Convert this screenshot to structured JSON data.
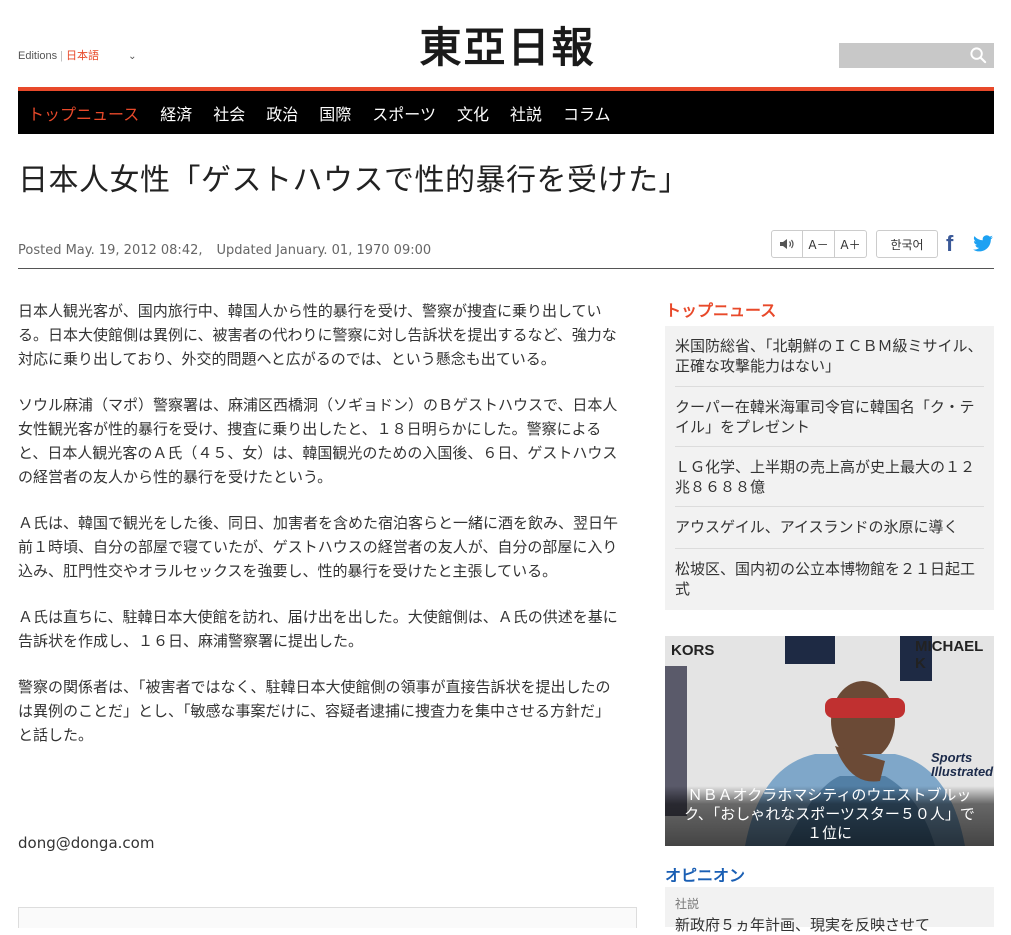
{
  "header": {
    "editions_label": "Editions",
    "edition_lang": "日本語",
    "logo_text": "東亞日報",
    "search_placeholder": ""
  },
  "nav": {
    "items": [
      "トップニュース",
      "経済",
      "社会",
      "政治",
      "国際",
      "スポーツ",
      "文化",
      "社説",
      "コラム"
    ],
    "active_index": 0
  },
  "article": {
    "title": "日本人女性「ゲストハウスで性的暴行を受けた」",
    "posted": "Posted May. 19, 2012 08:42,",
    "updated": "Updated January. 01, 1970 09:00",
    "paragraphs": [
      "日本人観光客が、国内旅行中、韓国人から性的暴行を受け、警察が捜査に乗り出している。日本大使館側は異例に、被害者の代わりに警察に対し告訴状を提出するなど、強力な対応に乗り出しており、外交的問題へと広がるのでは、という懸念も出ている。",
      "ソウル麻浦（マポ）警察署は、麻浦区西橋洞（ソギョドン）のＢゲストハウスで、日本人女性観光客が性的暴行を受け、捜査に乗り出したと、１８日明らかにした。警察によると、日本人観光客のＡ氏（４５、女）は、韓国観光のための入国後、６日、ゲストハウスの経営者の友人から性的暴行を受けたという。",
      "Ａ氏は、韓国で観光をした後、同日、加害者を含めた宿泊客らと一緒に酒を飲み、翌日午前１時頃、自分の部屋で寝ていたが、ゲストハウスの経営者の友人が、自分の部屋に入り込み、肛門性交やオラルセックスを強要し、性的暴行を受けたと主張している。",
      "Ａ氏は直ちに、駐韓日本大使館を訪れ、届け出を出した。大使館側は、Ａ氏の供述を基に告訴状を作成し、１６日、麻浦警察署に提出した。",
      "警察の関係者は、「被害者ではなく、駐韓日本大使館側の領事が直接告訴状を提出したのは異例のことだ」とし、「敏感な事案だけに、容疑者逮捕に捜査力を集中させる方針だ」と話した。"
    ],
    "byline": "dong@donga.com"
  },
  "tools": {
    "speaker_icon": "speaker-icon",
    "font_minus": "A－",
    "font_plus": "A＋",
    "korean": "한국어"
  },
  "sidebar": {
    "top_news_title": "トップニュース",
    "top_news": [
      "米国防総省、「北朝鮮のＩＣＢＭ級ミサイル、正確な攻撃能力はない」",
      "クーパー在韓米海軍司令官に韓国名「ク・テイル」をプレゼント",
      "ＬＧ化学、上半期の売上高が史上最大の１２兆８６８８億",
      "アウスゲイル、アイスランドの氷原に導く",
      "松坡区、国内初の公立本博物館を２１日起工式"
    ],
    "photo": {
      "brand_left": "KORS",
      "brand_right": "MICHAEL K",
      "brand_sports": "Sports Illustrated",
      "caption": "ＮＢＡオクラホマシティのウエストブルック、「おしゃれなスポーツスター５０人」で１位に"
    },
    "opinion_title": "オピニオン",
    "opinion": {
      "category": "社説",
      "title": "新政府５ヵ年計画、現実を反映させて"
    }
  },
  "colors": {
    "accent": "#e8492a",
    "nav_bg": "#000000",
    "opinion": "#1a5fb4"
  }
}
